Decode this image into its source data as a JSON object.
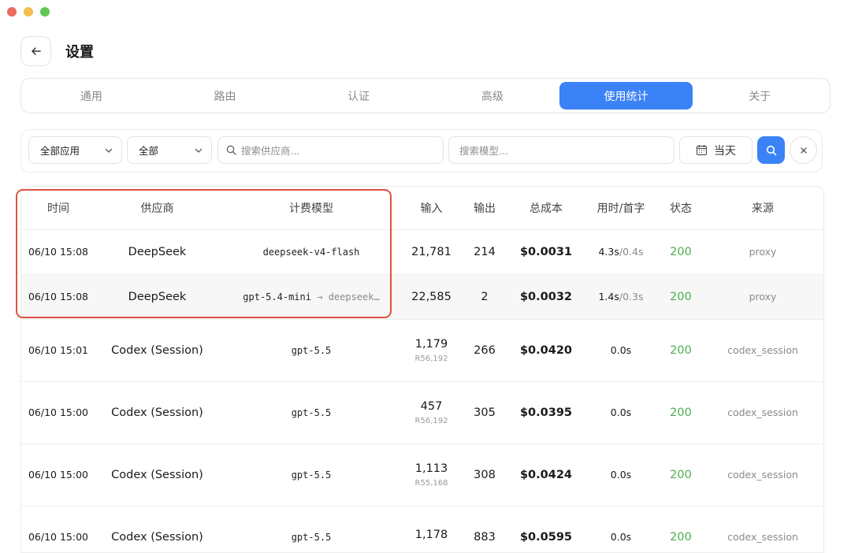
{
  "header": {
    "title": "设置"
  },
  "tabs": [
    {
      "label": "通用",
      "active": false
    },
    {
      "label": "路由",
      "active": false
    },
    {
      "label": "认证",
      "active": false
    },
    {
      "label": "高级",
      "active": false
    },
    {
      "label": "使用统计",
      "active": true
    },
    {
      "label": "关于",
      "active": false
    }
  ],
  "filters": {
    "app_select": "全部应用",
    "status_select": "全部",
    "provider_search_placeholder": "搜索供应商...",
    "model_search_placeholder": "搜索模型...",
    "date_label": "当天"
  },
  "table": {
    "columns": [
      "时间",
      "供应商",
      "计费模型",
      "输入",
      "输出",
      "总成本",
      "用时/首字",
      "状态",
      "来源"
    ],
    "rows": [
      {
        "time": "06/10 15:08",
        "provider": "DeepSeek",
        "model": "deepseek-v4-flash",
        "model_target": "",
        "input": "21,781",
        "input_sub": "",
        "output": "214",
        "cost": "$0.0031",
        "duration": "4.3s",
        "first_token": "/0.4s",
        "status": "200",
        "source": "proxy"
      },
      {
        "time": "06/10 15:08",
        "provider": "DeepSeek",
        "model": "gpt-5.4-mini",
        "model_target": "deepseek…",
        "input": "22,585",
        "input_sub": "",
        "output": "2",
        "cost": "$0.0032",
        "duration": "1.4s",
        "first_token": "/0.3s",
        "status": "200",
        "source": "proxy"
      },
      {
        "time": "06/10 15:01",
        "provider": "Codex (Session)",
        "model": "gpt-5.5",
        "model_target": "",
        "input": "1,179",
        "input_sub": "R56,192",
        "output": "266",
        "cost": "$0.0420",
        "duration": "0.0s",
        "first_token": "",
        "status": "200",
        "source": "codex_session"
      },
      {
        "time": "06/10 15:00",
        "provider": "Codex (Session)",
        "model": "gpt-5.5",
        "model_target": "",
        "input": "457",
        "input_sub": "R56,192",
        "output": "305",
        "cost": "$0.0395",
        "duration": "0.0s",
        "first_token": "",
        "status": "200",
        "source": "codex_session"
      },
      {
        "time": "06/10 15:00",
        "provider": "Codex (Session)",
        "model": "gpt-5.5",
        "model_target": "",
        "input": "1,113",
        "input_sub": "R55,168",
        "output": "308",
        "cost": "$0.0424",
        "duration": "0.0s",
        "first_token": "",
        "status": "200",
        "source": "codex_session"
      },
      {
        "time": "06/10 15:00",
        "provider": "Codex (Session)",
        "model": "gpt-5.5",
        "model_target": "",
        "input": "1,178",
        "input_sub": "",
        "output": "883",
        "cost": "$0.0595",
        "duration": "0.0s",
        "first_token": "",
        "status": "200",
        "source": "codex_session"
      }
    ]
  },
  "icons": {
    "back": "arrow-left-icon",
    "dropdown": "chevron-down-icon",
    "search": "search-icon",
    "calendar": "calendar-icon",
    "clear": "close-icon"
  },
  "colors": {
    "accent": "#3b82f6",
    "status_ok": "#4caf50",
    "highlight_border": "#e0533f"
  }
}
